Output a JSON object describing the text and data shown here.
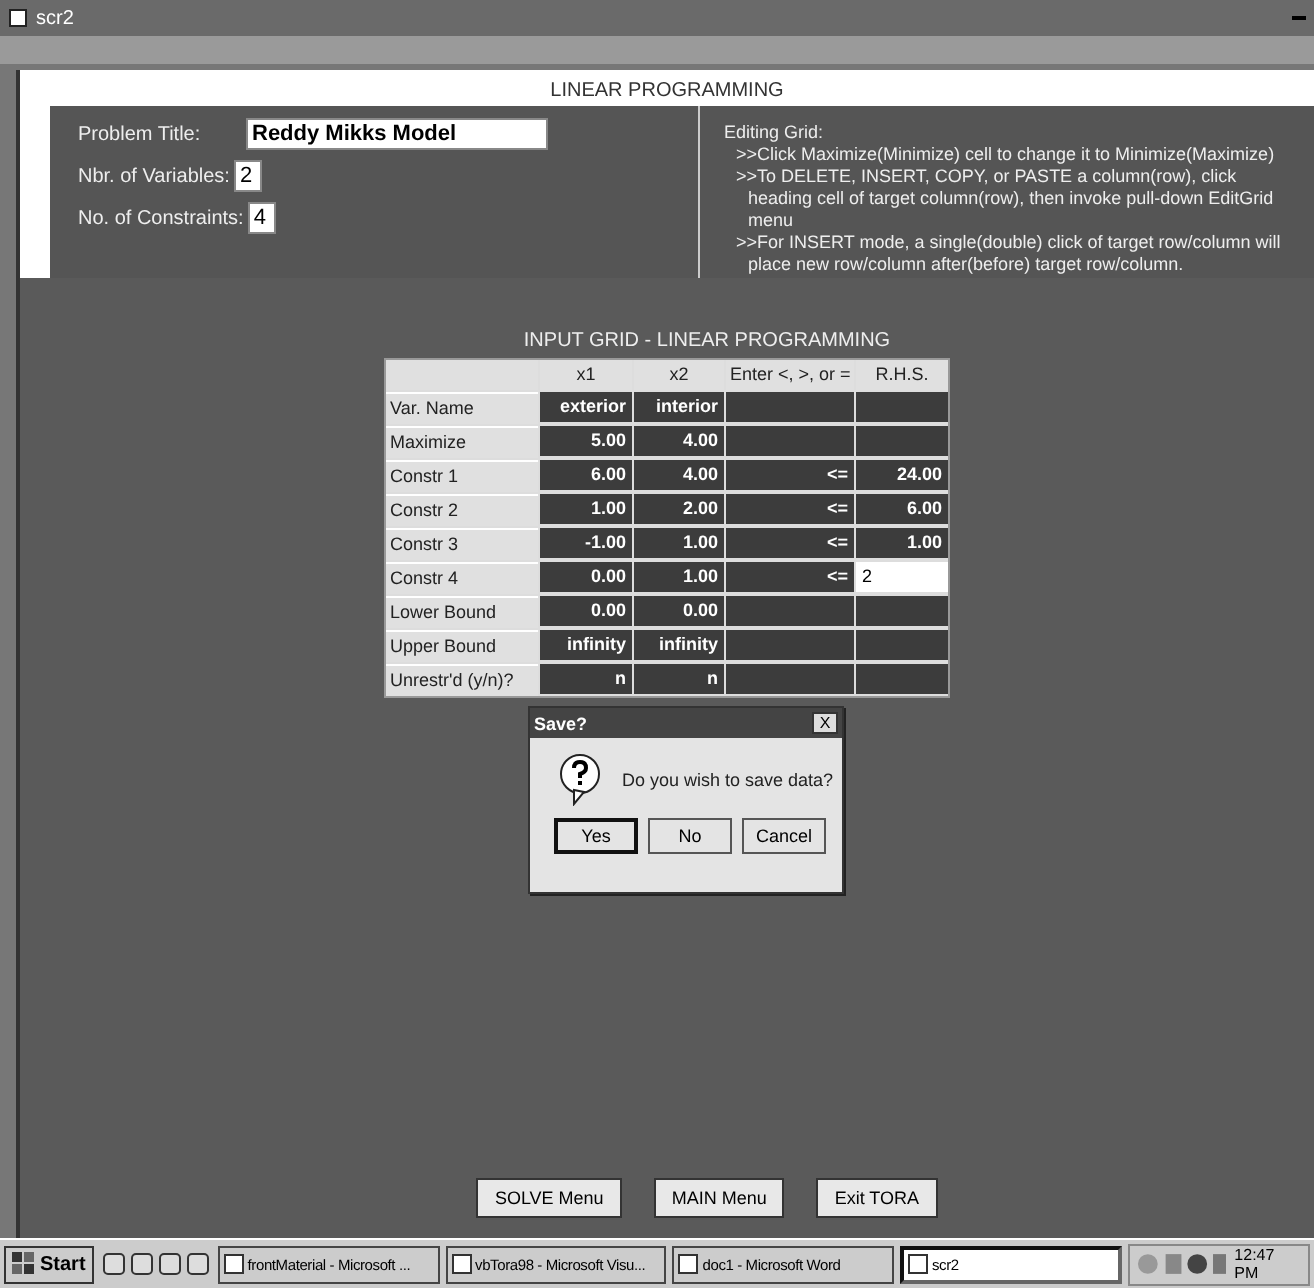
{
  "window": {
    "title": "scr2"
  },
  "header": "LINEAR PROGRAMMING",
  "problem": [
    {
      "label": "Problem Title:",
      "value": "Reddy Mikks Model",
      "kind": "wide"
    },
    {
      "label": "Nbr. of Variables:",
      "value": "2",
      "kind": "narrow"
    },
    {
      "label": "No. of Constraints:",
      "value": "4",
      "kind": "narrow"
    }
  ],
  "instructions": {
    "title": "Editing Grid:",
    "lines": [
      ">>Click Maximize(Minimize) cell to change it to Minimize(Maximize)",
      ">>To DELETE, INSERT, COPY, or PASTE a column(row), click heading cell of target column(row), then invoke pull-down EditGrid menu",
      ">>For INSERT mode, a single(double) click of target row/column will place new row/column after(before) target row/column."
    ]
  },
  "grid": {
    "title": "INPUT GRID - LINEAR PROGRAMMING",
    "columns": [
      "x1",
      "x2",
      "Enter <, >, or =",
      "R.H.S."
    ],
    "rows": [
      {
        "label": "Var. Name",
        "cells": [
          "exterior",
          "interior",
          null,
          null
        ],
        "editing": false
      },
      {
        "label": "Maximize",
        "cells": [
          "5.00",
          "4.00",
          null,
          null
        ],
        "editing": false
      },
      {
        "label": "Constr 1",
        "cells": [
          "6.00",
          "4.00",
          "<=",
          "24.00"
        ],
        "editing": false
      },
      {
        "label": "Constr 2",
        "cells": [
          "1.00",
          "2.00",
          "<=",
          "6.00"
        ],
        "editing": false
      },
      {
        "label": "Constr 3",
        "cells": [
          "-1.00",
          "1.00",
          "<=",
          "1.00"
        ],
        "editing": false
      },
      {
        "label": "Constr 4",
        "cells": [
          "0.00",
          "1.00",
          "<=",
          "2"
        ],
        "editing": true
      },
      {
        "label": "Lower Bound",
        "cells": [
          "0.00",
          "0.00",
          null,
          null
        ],
        "editing": false
      },
      {
        "label": "Upper Bound",
        "cells": [
          "infinity",
          "infinity",
          null,
          null
        ],
        "editing": false
      },
      {
        "label": "Unrestr'd (y/n)?",
        "cells": [
          "n",
          "n",
          null,
          null
        ],
        "editing": false
      }
    ]
  },
  "dialog": {
    "title": "Save?",
    "close": "X",
    "message": "Do you wish to save data?",
    "buttons": [
      {
        "label": "Yes",
        "selected": true
      },
      {
        "label": "No",
        "selected": false
      },
      {
        "label": "Cancel",
        "selected": false
      }
    ]
  },
  "bottom_buttons": [
    "SOLVE Menu",
    "MAIN Menu",
    "Exit TORA"
  ],
  "taskbar": {
    "start": "Start",
    "tasks": [
      {
        "label": "frontMaterial - Microsoft ...",
        "selected": false
      },
      {
        "label": "vbTora98 - Microsoft Visu...",
        "selected": false
      },
      {
        "label": "doc1 - Microsoft Word",
        "selected": false
      },
      {
        "label": "scr2",
        "selected": true
      }
    ],
    "clock": "12:47 PM"
  }
}
